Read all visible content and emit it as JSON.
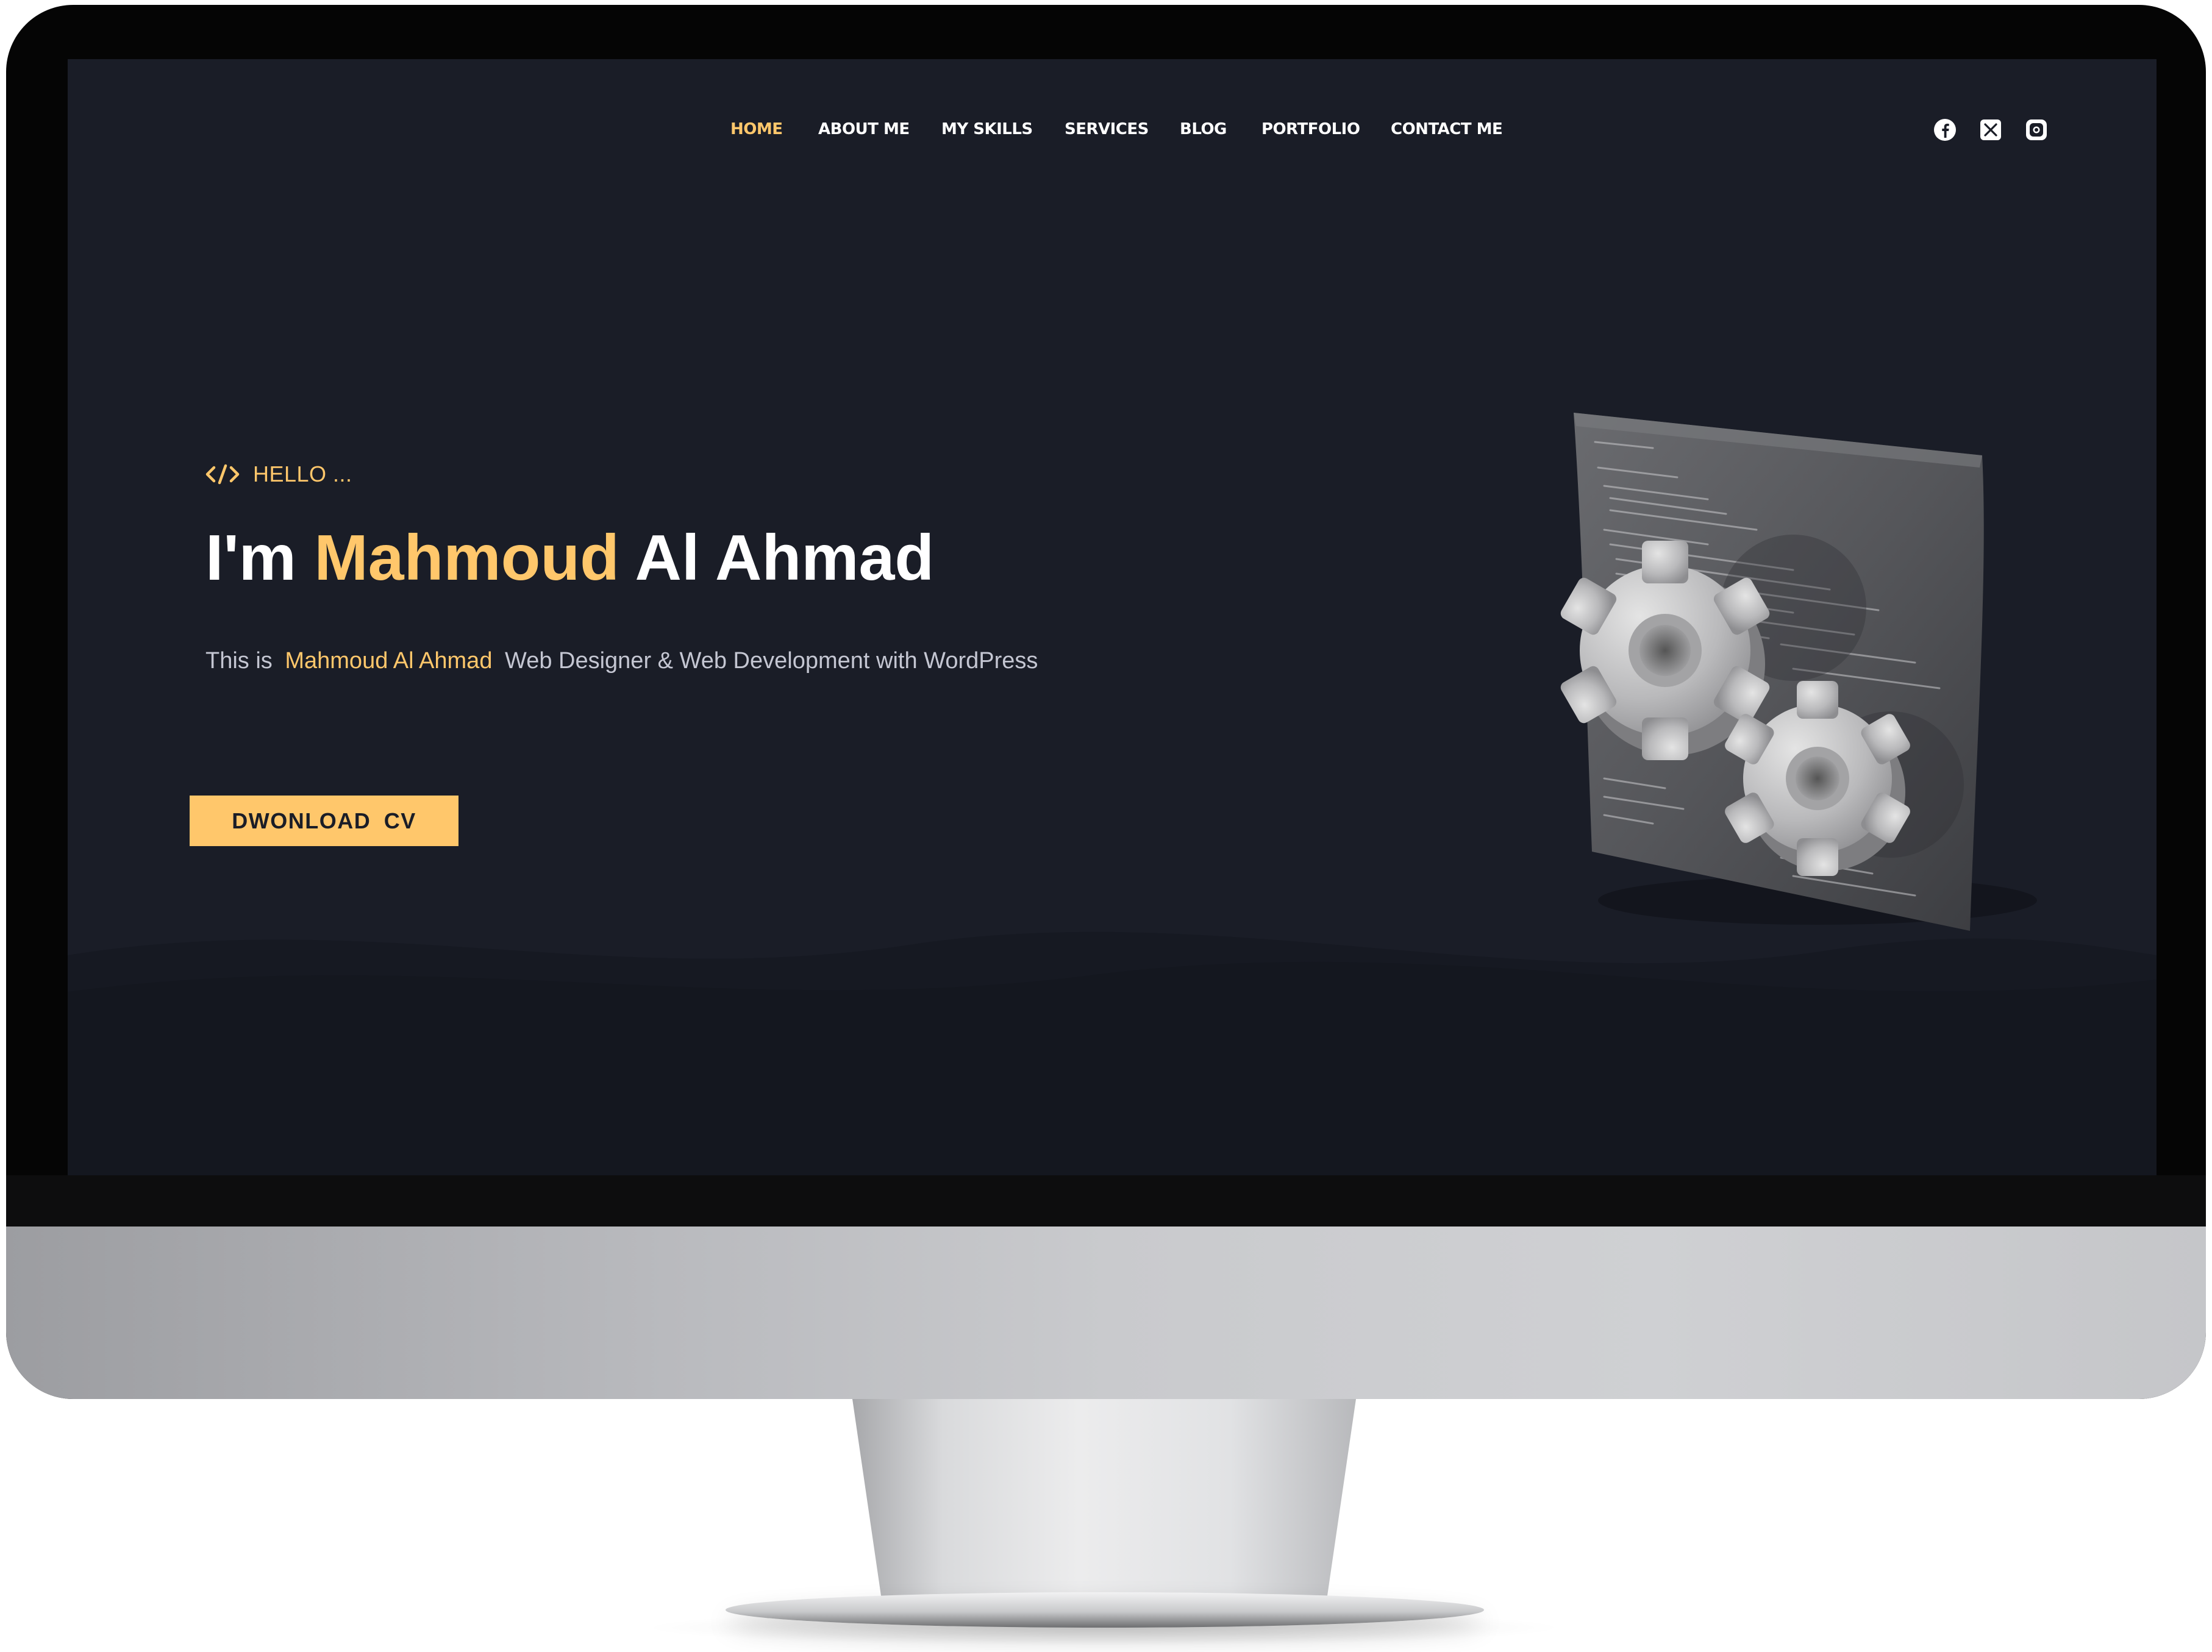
{
  "nav": {
    "items": [
      {
        "label": "HOME",
        "active": true
      },
      {
        "label": "ABOUT ME",
        "active": false
      },
      {
        "label": "MY SKILLS",
        "active": false
      },
      {
        "label": "SERVICES",
        "active": false
      },
      {
        "label": "BLOG",
        "active": false
      },
      {
        "label": "PORTFOLIO",
        "active": false
      },
      {
        "label": "CONTACT ME",
        "active": false
      }
    ]
  },
  "social": {
    "icons": [
      "facebook-icon",
      "x-twitter-icon",
      "instagram-icon"
    ]
  },
  "hero": {
    "hello_icon": "code-icon",
    "hello_text": "HELLO ...",
    "headline_prefix": "I'm",
    "headline_highlight": "Mahmoud",
    "headline_suffix": "Al Ahmad",
    "subtitle_prefix": "This is",
    "subtitle_highlight": "Mahmoud Al Ahmad",
    "subtitle_suffix": "Web Designer & Web Development with WordPress",
    "cta_label": "DWONLOAD  CV"
  },
  "illustration": {
    "icon": "gears-code-illustration"
  },
  "colors": {
    "background": "#1a1d27",
    "accent": "#ffc76b",
    "text": "#ffffff",
    "muted_text": "#c4c6d2"
  }
}
